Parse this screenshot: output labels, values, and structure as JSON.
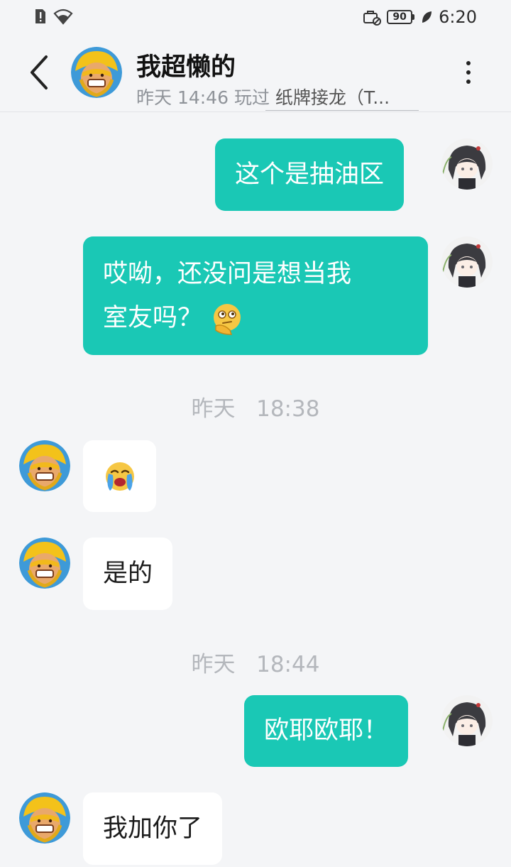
{
  "status_bar": {
    "battery_level": "90",
    "time": "6:20"
  },
  "header": {
    "contact_name": "我超懒的",
    "last_seen": "昨天 14:46 玩过",
    "game_name": "纸牌接龙（T..."
  },
  "messages": [
    {
      "direction": "out",
      "text": "这个是抽油区"
    },
    {
      "direction": "out",
      "text": "哎呦，还没问是想当我室友吗？",
      "line1": "哎呦，还没问是想当我",
      "line2": "室友吗？",
      "emoji": "thinking-face"
    },
    {
      "type": "timestamp",
      "text": "昨天   18:38"
    },
    {
      "direction": "in",
      "emoji": "crying-face"
    },
    {
      "direction": "in",
      "text": "是的"
    },
    {
      "type": "timestamp",
      "text": "昨天   18:44"
    },
    {
      "direction": "out",
      "text": "欧耶欧耶！"
    },
    {
      "direction": "in",
      "text": "我加你了"
    }
  ],
  "colors": {
    "outgoing_bubble": "#1ac8b5",
    "incoming_bubble": "#ffffff",
    "background": "#f4f5f7"
  }
}
